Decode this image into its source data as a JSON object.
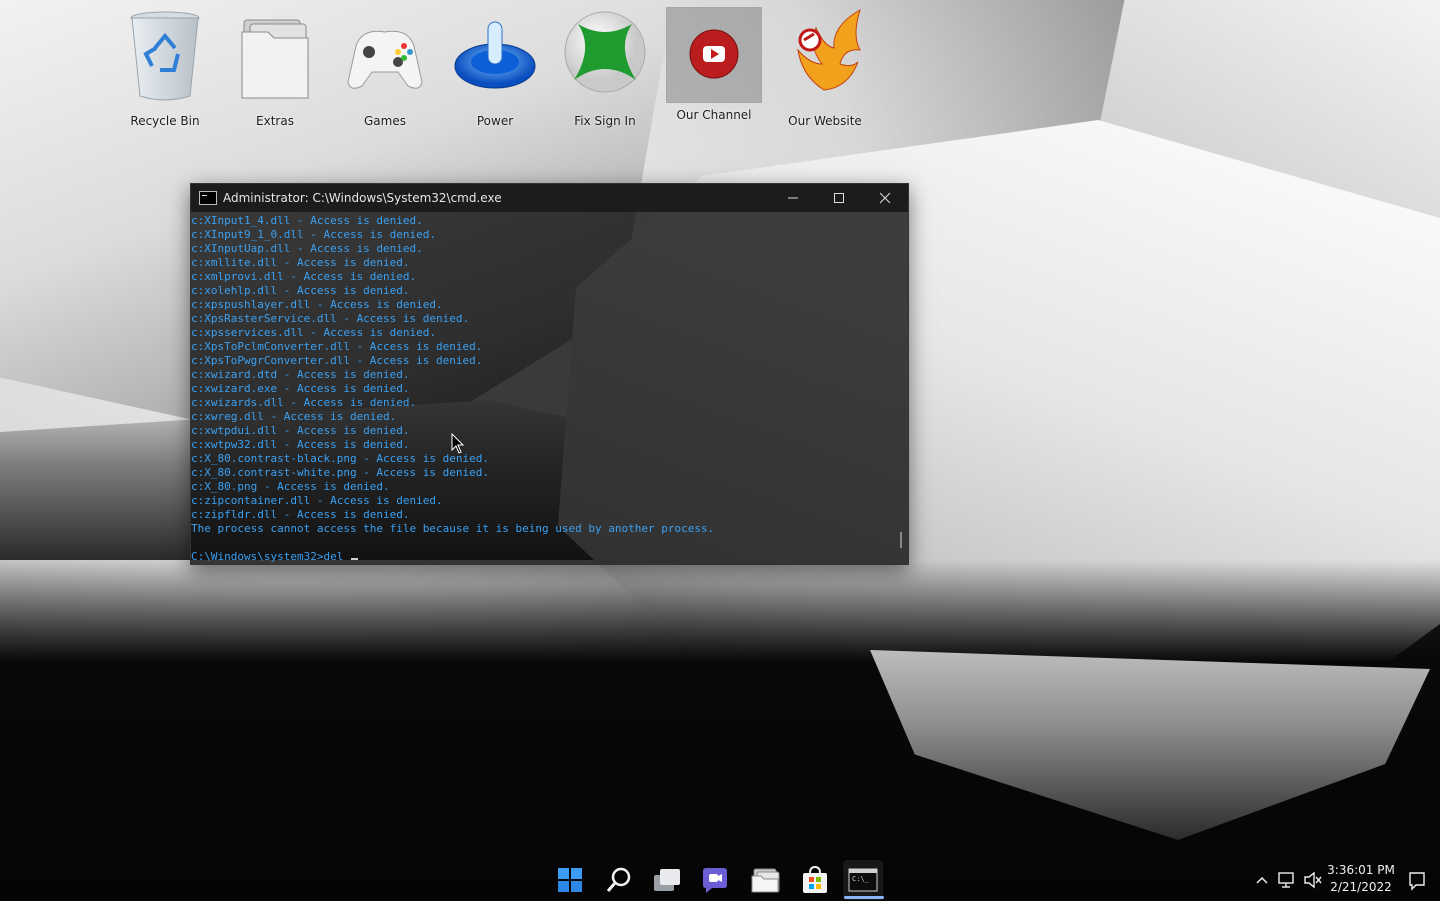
{
  "desktop": {
    "icons": [
      {
        "label": "Recycle Bin",
        "icon": "recycle-bin-icon"
      },
      {
        "label": "Extras",
        "icon": "folder-icon"
      },
      {
        "label": "Games",
        "icon": "gamepad-icon"
      },
      {
        "label": "Power",
        "icon": "power-icon"
      },
      {
        "label": "Fix Sign In",
        "icon": "xbox-icon"
      },
      {
        "label": "Our Channel",
        "icon": "youtube-icon"
      },
      {
        "label": "Our Website",
        "icon": "phoenix-icon"
      }
    ]
  },
  "cmd": {
    "title": "Administrator: C:\\Windows\\System32\\cmd.exe",
    "lines": [
      "c:XInput1_4.dll - Access is denied.",
      "c:XInput9_1_0.dll - Access is denied.",
      "c:XInputUap.dll - Access is denied.",
      "c:xmllite.dll - Access is denied.",
      "c:xmlprovi.dll - Access is denied.",
      "c:xolehlp.dll - Access is denied.",
      "c:xpspushlayer.dll - Access is denied.",
      "c:XpsRasterService.dll - Access is denied.",
      "c:xpsservices.dll - Access is denied.",
      "c:XpsToPclmConverter.dll - Access is denied.",
      "c:XpsToPwgrConverter.dll - Access is denied.",
      "c:xwizard.dtd - Access is denied.",
      "c:xwizard.exe - Access is denied.",
      "c:xwizards.dll - Access is denied.",
      "c:xwreg.dll - Access is denied.",
      "c:xwtpdui.dll - Access is denied.",
      "c:xwtpw32.dll - Access is denied.",
      "c:X_80.contrast-black.png - Access is denied.",
      "c:X_80.contrast-white.png - Access is denied.",
      "c:X_80.png - Access is denied.",
      "c:zipcontainer.dll - Access is denied.",
      "c:zipfldr.dll - Access is denied.",
      "The process cannot access the file because it is being used by another process.",
      ""
    ],
    "prompt": "C:\\Windows\\system32>del "
  },
  "taskbar": {
    "items": [
      {
        "name": "start",
        "icon": "windows-logo-icon"
      },
      {
        "name": "search",
        "icon": "search-icon"
      },
      {
        "name": "task-view",
        "icon": "task-view-icon"
      },
      {
        "name": "chat",
        "icon": "chat-icon"
      },
      {
        "name": "file-explorer",
        "icon": "file-explorer-icon"
      },
      {
        "name": "store",
        "icon": "store-icon"
      },
      {
        "name": "terminal",
        "icon": "cmd-icon",
        "active": true
      }
    ],
    "tray": {
      "time": "3:36:01 PM",
      "date": "2/21/2022"
    }
  },
  "colors": {
    "console_text": "#3aa0f2",
    "taskbar_indicator": "#8ab4f8"
  }
}
